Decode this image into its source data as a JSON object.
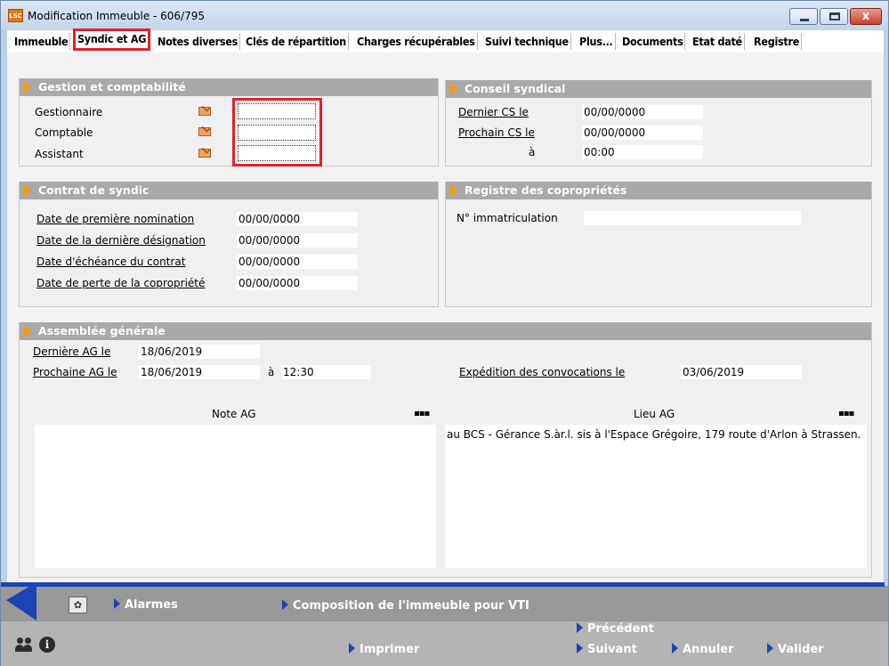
{
  "window": {
    "app_icon": "LSC",
    "title": "Modification Immeuble - 606/795",
    "close_glyph": "x"
  },
  "tabs": [
    {
      "label": "Immeuble"
    },
    {
      "label": "Syndic et AG",
      "active": true
    },
    {
      "label": "Notes diverses"
    },
    {
      "label": "Clés de répartition"
    },
    {
      "label": "Charges récupérables"
    },
    {
      "label": "Suivi technique"
    },
    {
      "label": "Plus..."
    },
    {
      "label": "Documents"
    },
    {
      "label": "Etat daté"
    },
    {
      "label": "Registre"
    }
  ],
  "gestion": {
    "title": "Gestion et comptabilité",
    "rows": [
      {
        "label": "Gestionnaire",
        "value": ""
      },
      {
        "label": "Comptable",
        "value": ""
      },
      {
        "label": "Assistant",
        "value": ""
      }
    ]
  },
  "conseil": {
    "title": "Conseil syndical",
    "dernier_label": "Dernier CS le",
    "dernier_value": "00/00/0000",
    "prochain_label": "Prochain CS le",
    "prochain_value": "00/00/0000",
    "a_label": "à",
    "a_value": "00:00"
  },
  "contrat": {
    "title": "Contrat de syndic",
    "rows": [
      {
        "label": "Date de première nomination",
        "value": "00/00/0000"
      },
      {
        "label": "Date de la dernière désignation",
        "value": "00/00/0000"
      },
      {
        "label": "Date d'échéance du contrat",
        "value": "00/00/0000"
      },
      {
        "label": "Date de perte de la copropriété",
        "value": "00/00/0000"
      }
    ]
  },
  "registre": {
    "title": "Registre des copropriétés",
    "immat_label": "N° immatriculation",
    "immat_value": ""
  },
  "ag": {
    "title": "Assemblée générale",
    "derniere_label": "Dernière AG le",
    "derniere_value": "18/06/2019",
    "prochaine_label": "Prochaine AG le",
    "prochaine_value": "18/06/2019",
    "a_label": "à",
    "a_value": "12:30",
    "expedition_label": "Expédition des convocations le",
    "expedition_value": "03/06/2019",
    "note_label": "Note AG",
    "note_value": "",
    "lieu_label": "Lieu AG",
    "lieu_value": "au BCS - Gérance S.àr.l. sis à l'Espace Grégoire, 179 route d'Arlon à Strassen.",
    "dots": "▪▪▪"
  },
  "bottom": {
    "alarmes": "Alarmes",
    "composition": "Composition de l'immeuble pour VTI",
    "precedent": "Précédent",
    "imprimer": "Imprimer",
    "suivant": "Suivant",
    "annuler": "Annuler",
    "valider": "Valider",
    "info_glyph": "i"
  },
  "colors": {
    "accent_orange": "#f29a1b",
    "highlight_red": "#e0222a",
    "nav_blue": "#1c44b4",
    "panel_header": "#a9a9a9"
  }
}
